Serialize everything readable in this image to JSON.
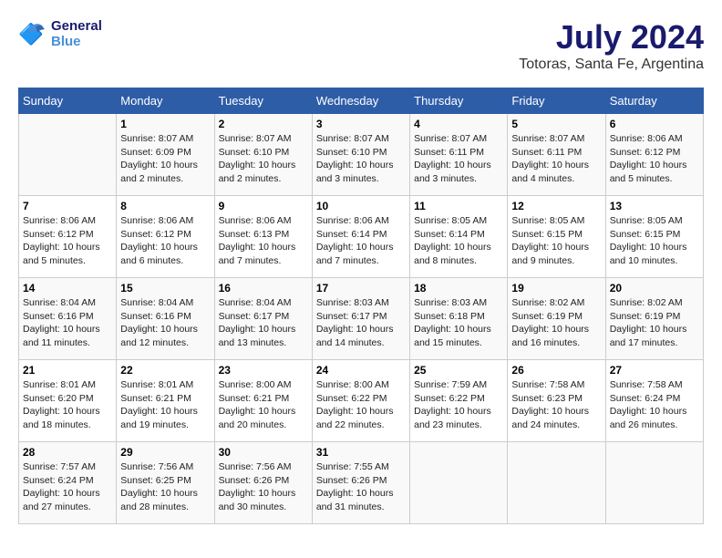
{
  "header": {
    "logo_line1": "General",
    "logo_line2": "Blue",
    "title": "July 2024",
    "subtitle": "Totoras, Santa Fe, Argentina"
  },
  "days_of_week": [
    "Sunday",
    "Monday",
    "Tuesday",
    "Wednesday",
    "Thursday",
    "Friday",
    "Saturday"
  ],
  "weeks": [
    [
      {
        "day": "",
        "info": ""
      },
      {
        "day": "1",
        "info": "Sunrise: 8:07 AM\nSunset: 6:09 PM\nDaylight: 10 hours\nand 2 minutes."
      },
      {
        "day": "2",
        "info": "Sunrise: 8:07 AM\nSunset: 6:10 PM\nDaylight: 10 hours\nand 2 minutes."
      },
      {
        "day": "3",
        "info": "Sunrise: 8:07 AM\nSunset: 6:10 PM\nDaylight: 10 hours\nand 3 minutes."
      },
      {
        "day": "4",
        "info": "Sunrise: 8:07 AM\nSunset: 6:11 PM\nDaylight: 10 hours\nand 3 minutes."
      },
      {
        "day": "5",
        "info": "Sunrise: 8:07 AM\nSunset: 6:11 PM\nDaylight: 10 hours\nand 4 minutes."
      },
      {
        "day": "6",
        "info": "Sunrise: 8:06 AM\nSunset: 6:12 PM\nDaylight: 10 hours\nand 5 minutes."
      }
    ],
    [
      {
        "day": "7",
        "info": "Sunrise: 8:06 AM\nSunset: 6:12 PM\nDaylight: 10 hours\nand 5 minutes."
      },
      {
        "day": "8",
        "info": "Sunrise: 8:06 AM\nSunset: 6:12 PM\nDaylight: 10 hours\nand 6 minutes."
      },
      {
        "day": "9",
        "info": "Sunrise: 8:06 AM\nSunset: 6:13 PM\nDaylight: 10 hours\nand 7 minutes."
      },
      {
        "day": "10",
        "info": "Sunrise: 8:06 AM\nSunset: 6:14 PM\nDaylight: 10 hours\nand 7 minutes."
      },
      {
        "day": "11",
        "info": "Sunrise: 8:05 AM\nSunset: 6:14 PM\nDaylight: 10 hours\nand 8 minutes."
      },
      {
        "day": "12",
        "info": "Sunrise: 8:05 AM\nSunset: 6:15 PM\nDaylight: 10 hours\nand 9 minutes."
      },
      {
        "day": "13",
        "info": "Sunrise: 8:05 AM\nSunset: 6:15 PM\nDaylight: 10 hours\nand 10 minutes."
      }
    ],
    [
      {
        "day": "14",
        "info": "Sunrise: 8:04 AM\nSunset: 6:16 PM\nDaylight: 10 hours\nand 11 minutes."
      },
      {
        "day": "15",
        "info": "Sunrise: 8:04 AM\nSunset: 6:16 PM\nDaylight: 10 hours\nand 12 minutes."
      },
      {
        "day": "16",
        "info": "Sunrise: 8:04 AM\nSunset: 6:17 PM\nDaylight: 10 hours\nand 13 minutes."
      },
      {
        "day": "17",
        "info": "Sunrise: 8:03 AM\nSunset: 6:17 PM\nDaylight: 10 hours\nand 14 minutes."
      },
      {
        "day": "18",
        "info": "Sunrise: 8:03 AM\nSunset: 6:18 PM\nDaylight: 10 hours\nand 15 minutes."
      },
      {
        "day": "19",
        "info": "Sunrise: 8:02 AM\nSunset: 6:19 PM\nDaylight: 10 hours\nand 16 minutes."
      },
      {
        "day": "20",
        "info": "Sunrise: 8:02 AM\nSunset: 6:19 PM\nDaylight: 10 hours\nand 17 minutes."
      }
    ],
    [
      {
        "day": "21",
        "info": "Sunrise: 8:01 AM\nSunset: 6:20 PM\nDaylight: 10 hours\nand 18 minutes."
      },
      {
        "day": "22",
        "info": "Sunrise: 8:01 AM\nSunset: 6:21 PM\nDaylight: 10 hours\nand 19 minutes."
      },
      {
        "day": "23",
        "info": "Sunrise: 8:00 AM\nSunset: 6:21 PM\nDaylight: 10 hours\nand 20 minutes."
      },
      {
        "day": "24",
        "info": "Sunrise: 8:00 AM\nSunset: 6:22 PM\nDaylight: 10 hours\nand 22 minutes."
      },
      {
        "day": "25",
        "info": "Sunrise: 7:59 AM\nSunset: 6:22 PM\nDaylight: 10 hours\nand 23 minutes."
      },
      {
        "day": "26",
        "info": "Sunrise: 7:58 AM\nSunset: 6:23 PM\nDaylight: 10 hours\nand 24 minutes."
      },
      {
        "day": "27",
        "info": "Sunrise: 7:58 AM\nSunset: 6:24 PM\nDaylight: 10 hours\nand 26 minutes."
      }
    ],
    [
      {
        "day": "28",
        "info": "Sunrise: 7:57 AM\nSunset: 6:24 PM\nDaylight: 10 hours\nand 27 minutes."
      },
      {
        "day": "29",
        "info": "Sunrise: 7:56 AM\nSunset: 6:25 PM\nDaylight: 10 hours\nand 28 minutes."
      },
      {
        "day": "30",
        "info": "Sunrise: 7:56 AM\nSunset: 6:26 PM\nDaylight: 10 hours\nand 30 minutes."
      },
      {
        "day": "31",
        "info": "Sunrise: 7:55 AM\nSunset: 6:26 PM\nDaylight: 10 hours\nand 31 minutes."
      },
      {
        "day": "",
        "info": ""
      },
      {
        "day": "",
        "info": ""
      },
      {
        "day": "",
        "info": ""
      }
    ]
  ]
}
